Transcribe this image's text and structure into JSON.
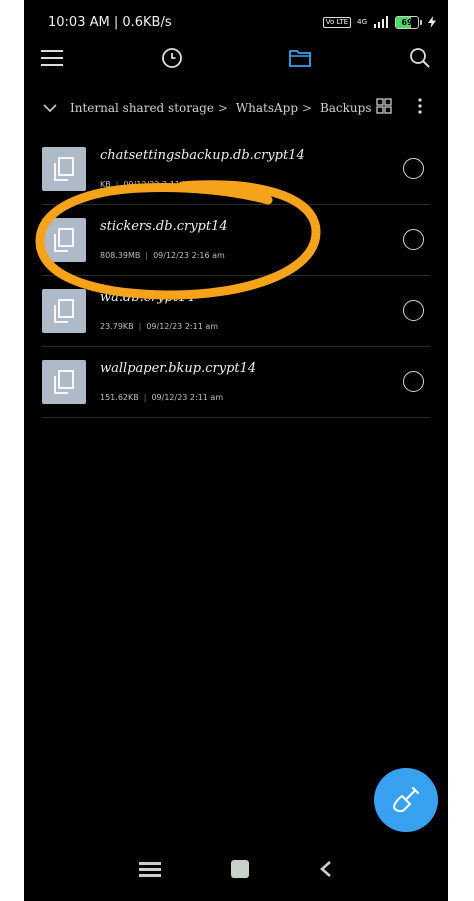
{
  "status_bar": {
    "time_speed": "10:03 AM | 0.6KB/s",
    "volte": "Vo LTE",
    "network": "4G",
    "battery": "69",
    "battery_level": 0.69
  },
  "breadcrumb": {
    "items": [
      "Internal shared storage",
      "WhatsApp",
      "Backups"
    ]
  },
  "files": [
    {
      "name": "chatsettingsbackup.db.crypt14",
      "size": "KB",
      "date": "09/12/23 2:11 am"
    },
    {
      "name": "stickers.db.crypt14",
      "size": "808.39MB",
      "date": "09/12/23 2:16 am"
    },
    {
      "name": "wa.db.crypt14",
      "size": "23.79KB",
      "date": "09/12/23 2:11 am"
    },
    {
      "name": "wallpaper.bkup.crypt14",
      "size": "151.62KB",
      "date": "09/12/23 2:11 am"
    }
  ],
  "colors": {
    "background": "#000000",
    "accent": "#39a2f0",
    "highlight": "#f5a31a",
    "file_icon": "#aebac8"
  },
  "icons": {
    "menu": "menu-icon",
    "recent": "clock-icon",
    "folder": "folder-icon",
    "search": "search-icon",
    "grid": "grid-view-icon",
    "more": "more-vert-icon",
    "clean": "broom-icon"
  }
}
